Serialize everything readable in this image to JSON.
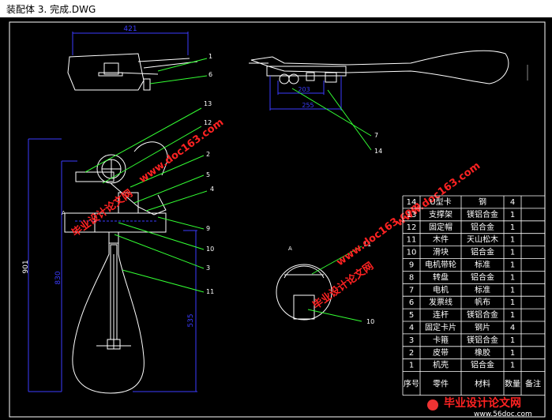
{
  "window": {
    "title": "装配体 3. 完成.DWG"
  },
  "dimensions": {
    "top_width": "421",
    "total_height": "901",
    "inner_height": "830",
    "lower_height": "535",
    "side_dim1": "255",
    "side_dim2": "203"
  },
  "callouts": [
    "1",
    "6",
    "13",
    "12",
    "2",
    "5",
    "4",
    "9",
    "10",
    "3",
    "11",
    "7",
    "14",
    "11",
    "10"
  ],
  "section_label": "A",
  "watermarks": {
    "site1": "www.doc163.com",
    "site2": "毕业设计论文网",
    "site3": "www.doc163.com",
    "site4": "毕业设计论文网",
    "site5": "www.doc163.com",
    "site6": "毕业设计论文网",
    "footer_cn": "毕业设计论文网",
    "footer_url": "www.56doc.com"
  },
  "bom": {
    "headers": [
      "序号",
      "零件",
      "材料",
      "数量",
      "备注"
    ],
    "rows": [
      [
        "14",
        "U型卡",
        "钢",
        "4"
      ],
      [
        "13",
        "支撑架",
        "镁铝合金",
        "1"
      ],
      [
        "12",
        "固定帽",
        "铝合金",
        "1"
      ],
      [
        "11",
        "木件",
        "天山松木",
        "1"
      ],
      [
        "10",
        "滑块",
        "铝合金",
        "1"
      ],
      [
        "9",
        "电机带轮",
        "标准",
        "1"
      ],
      [
        "8",
        "转盘",
        "铝合金",
        "1"
      ],
      [
        "7",
        "电机",
        "标准",
        "1"
      ],
      [
        "6",
        "发票线",
        "帆布",
        "1"
      ],
      [
        "5",
        "连杆",
        "镁铝合金",
        "1"
      ],
      [
        "4",
        "固定卡片",
        "钢片",
        "4"
      ],
      [
        "3",
        "卡箍",
        "镁铝合金",
        "1"
      ],
      [
        "2",
        "皮带",
        "橡胶",
        "1"
      ],
      [
        "1",
        "机壳",
        "铝合金",
        "1"
      ]
    ]
  },
  "colors": {
    "background": "#000000",
    "line": "#ffffff",
    "dim": "#3b3bff",
    "leader": "#33ff33",
    "watermark": "#ff2222"
  }
}
